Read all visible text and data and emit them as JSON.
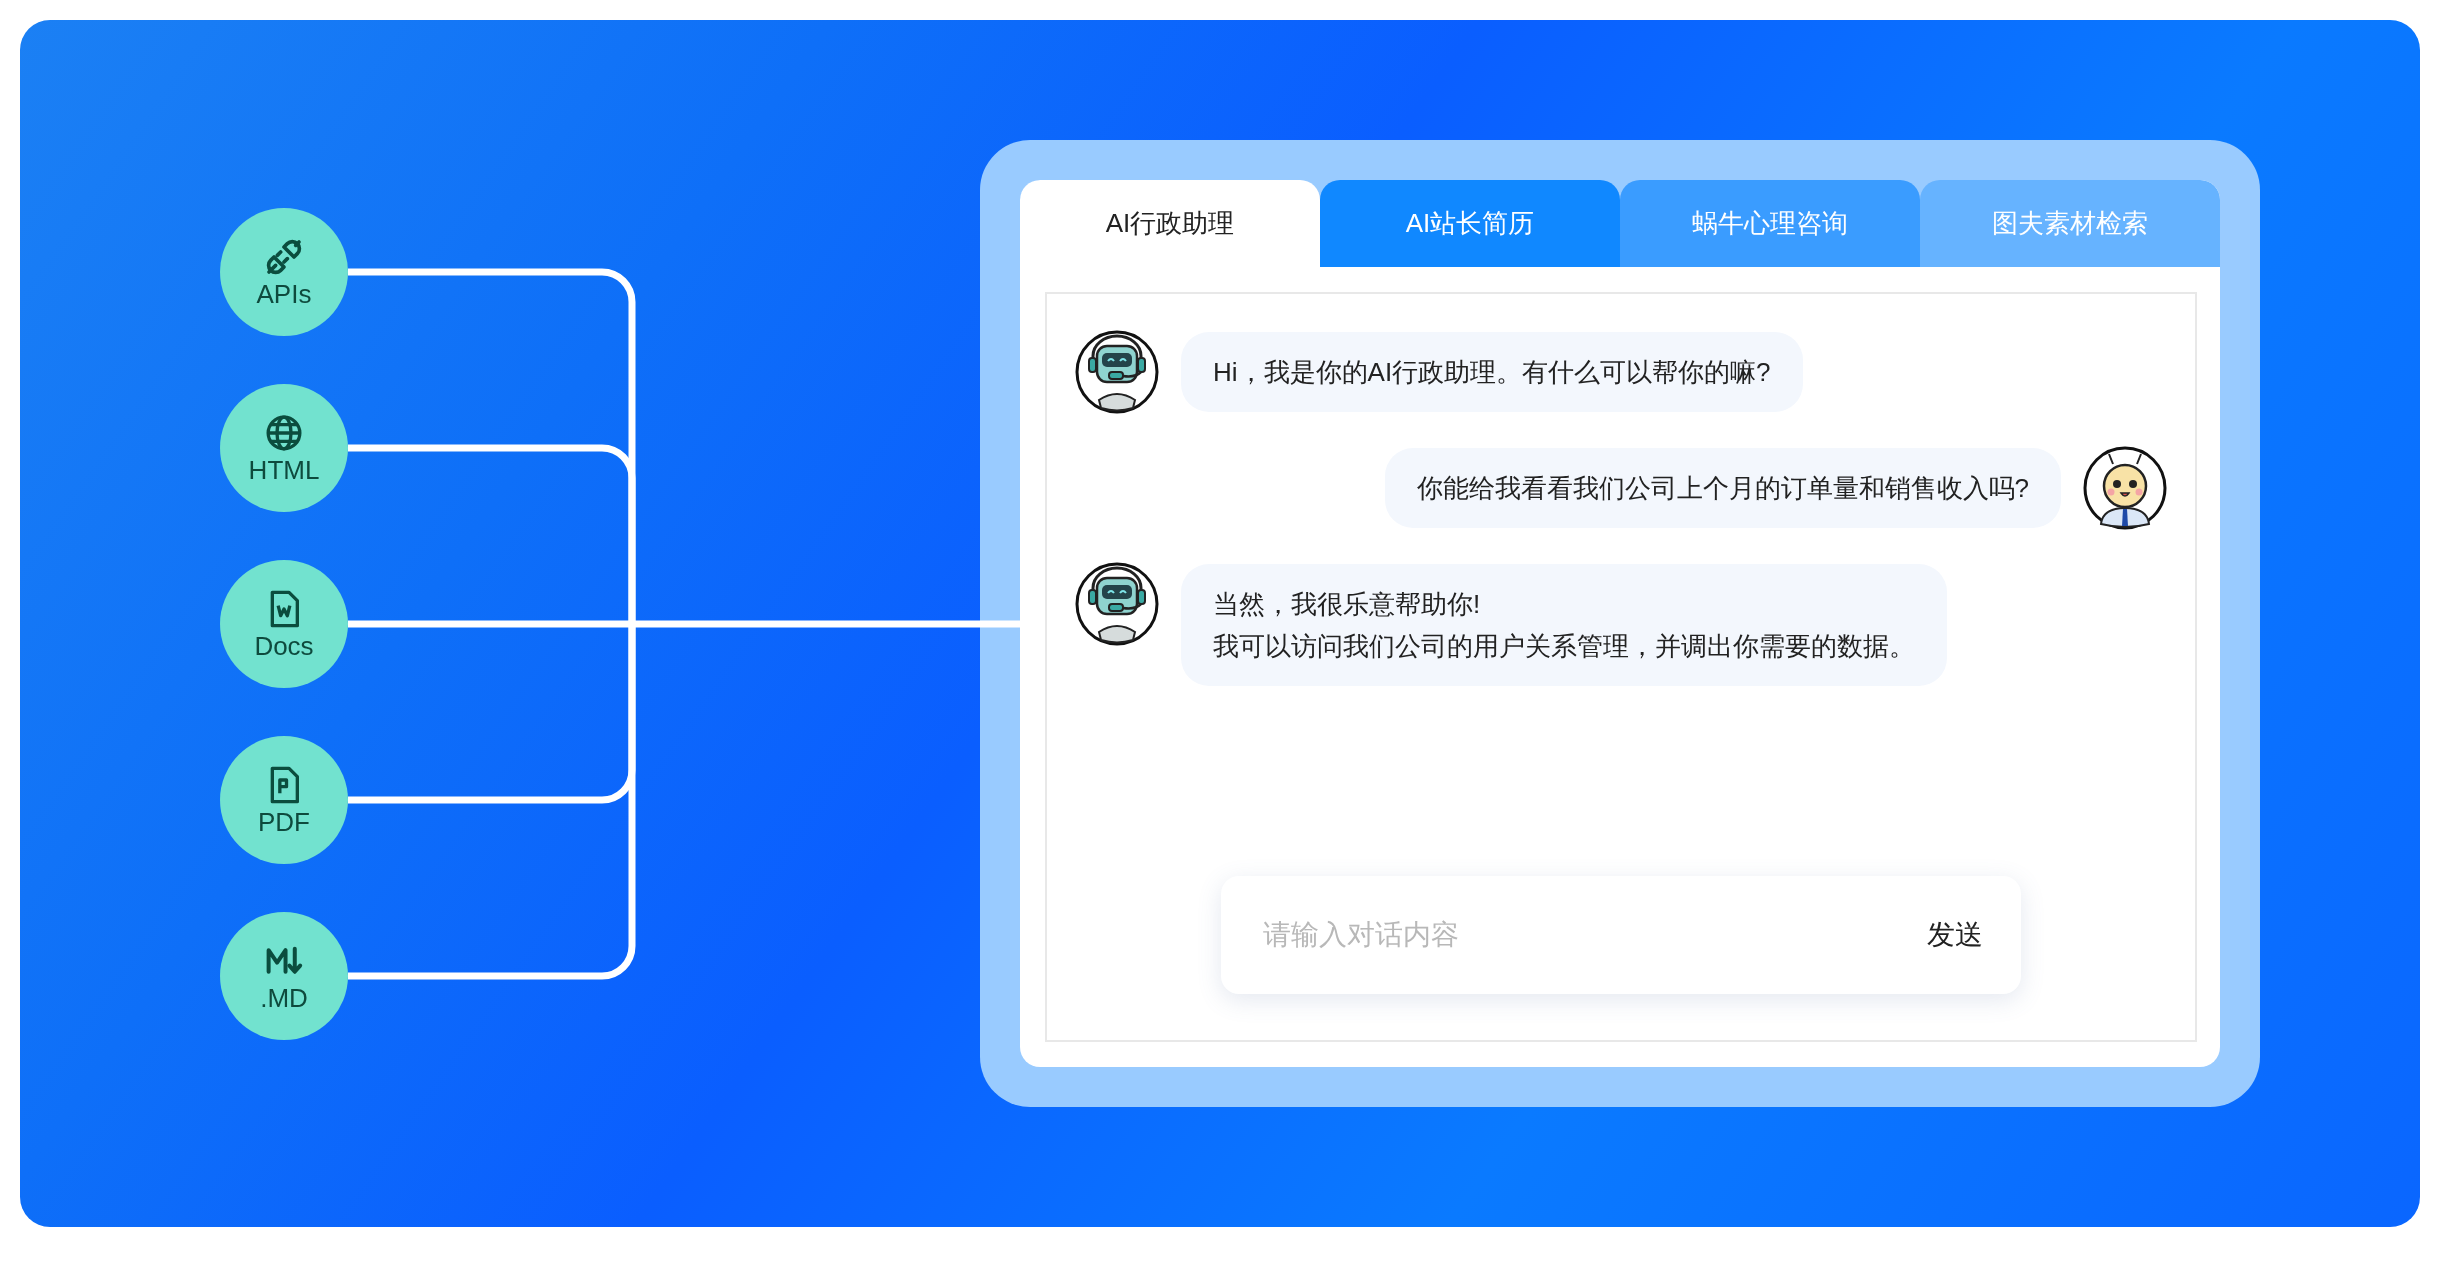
{
  "sources": [
    {
      "label": "APIs",
      "kind": "api"
    },
    {
      "label": "HTML",
      "kind": "html"
    },
    {
      "label": "Docs",
      "kind": "docs"
    },
    {
      "label": "PDF",
      "kind": "pdf"
    },
    {
      "label": ".MD",
      "kind": "md"
    }
  ],
  "tabs": [
    {
      "label": "AI行政助理",
      "selected": true
    },
    {
      "label": "AI站长简历",
      "selected": false,
      "color": "#1088ff"
    },
    {
      "label": "蜗牛心理咨询",
      "selected": false,
      "color": "#3a9cff"
    },
    {
      "label": "图夫素材检索",
      "selected": false,
      "color": "#66b3ff"
    }
  ],
  "messages": [
    {
      "kind": "assistant",
      "lines": [
        "Hi，我是你的AI行政助理。有什么可以帮你的嘛?"
      ]
    },
    {
      "kind": "user",
      "lines": [
        "你能给我看看我们公司上个月的订单量和销售收入吗?"
      ]
    },
    {
      "kind": "assistant",
      "lines": [
        "当然，我很乐意帮助你!",
        "我可以访问我们公司的用户关系管理，并调出你需要的数据。"
      ]
    }
  ],
  "input": {
    "placeholder": "请输入对话内容"
  },
  "send_button": "发送"
}
